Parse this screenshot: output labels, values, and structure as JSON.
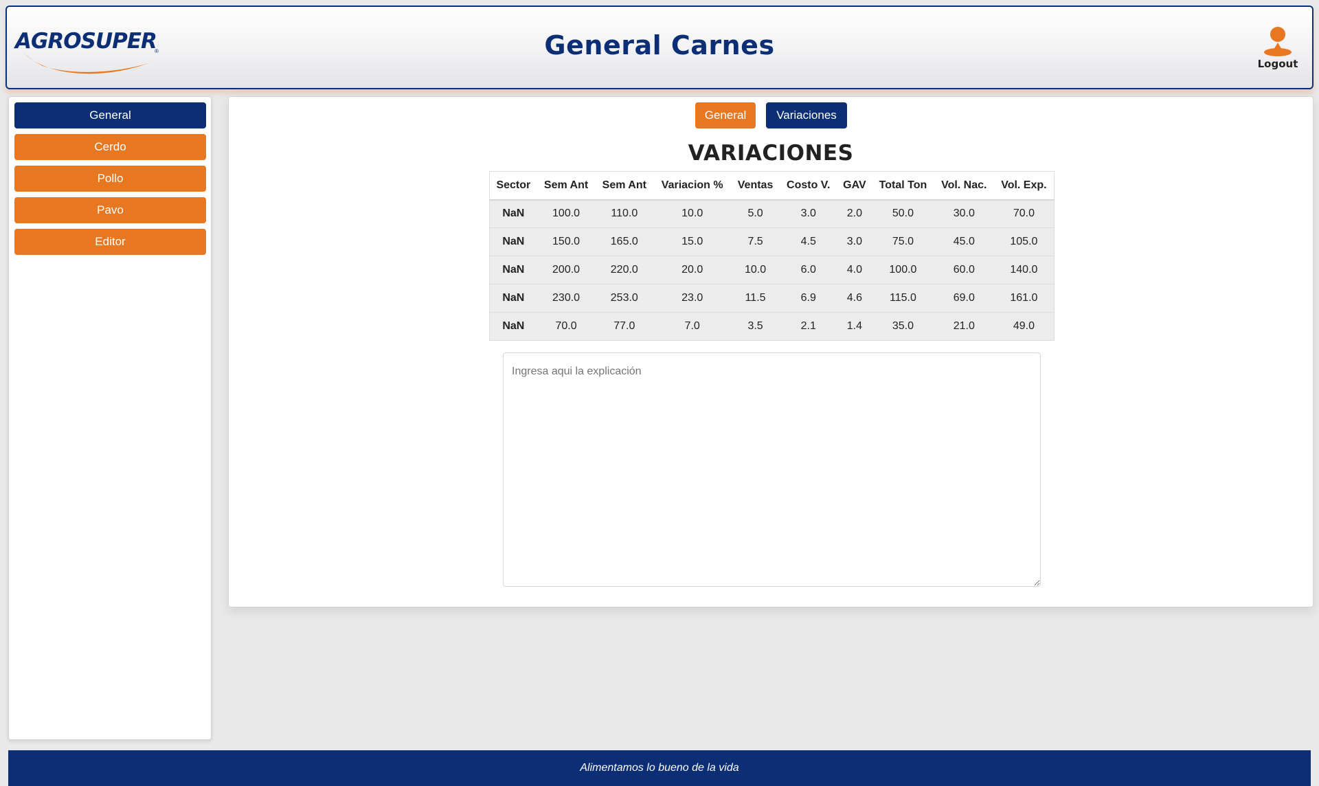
{
  "header": {
    "logo_text": "AGROSUPER",
    "logo_reg": "®",
    "title": "General Carnes",
    "logout_label": "Logout"
  },
  "sidebar": {
    "items": [
      {
        "label": "General",
        "active": true
      },
      {
        "label": "Cerdo",
        "active": false
      },
      {
        "label": "Pollo",
        "active": false
      },
      {
        "label": "Pavo",
        "active": false
      },
      {
        "label": "Editor",
        "active": false
      }
    ]
  },
  "main": {
    "tabs": [
      {
        "label": "General"
      },
      {
        "label": "Variaciones"
      }
    ],
    "section_title": "VARIACIONES",
    "table": {
      "columns": [
        "Sector",
        "Sem Ant",
        "Sem Ant",
        "Variacion %",
        "Ventas",
        "Costo V.",
        "GAV",
        "Total Ton",
        "Vol. Nac.",
        "Vol. Exp."
      ],
      "rows": [
        [
          "NaN",
          "100.0",
          "110.0",
          "10.0",
          "5.0",
          "3.0",
          "2.0",
          "50.0",
          "30.0",
          "70.0"
        ],
        [
          "NaN",
          "150.0",
          "165.0",
          "15.0",
          "7.5",
          "4.5",
          "3.0",
          "75.0",
          "45.0",
          "105.0"
        ],
        [
          "NaN",
          "200.0",
          "220.0",
          "20.0",
          "10.0",
          "6.0",
          "4.0",
          "100.0",
          "60.0",
          "140.0"
        ],
        [
          "NaN",
          "230.0",
          "253.0",
          "23.0",
          "11.5",
          "6.9",
          "4.6",
          "115.0",
          "69.0",
          "161.0"
        ],
        [
          "NaN",
          "70.0",
          "77.0",
          "7.0",
          "3.5",
          "2.1",
          "1.4",
          "35.0",
          "21.0",
          "49.0"
        ]
      ]
    },
    "explanation_placeholder": "Ingresa aqui la explicación"
  },
  "footer": {
    "slogan": "Alimentamos lo bueno de la vida"
  },
  "colors": {
    "brand_blue": "#0b2e74",
    "brand_orange": "#e87722"
  }
}
